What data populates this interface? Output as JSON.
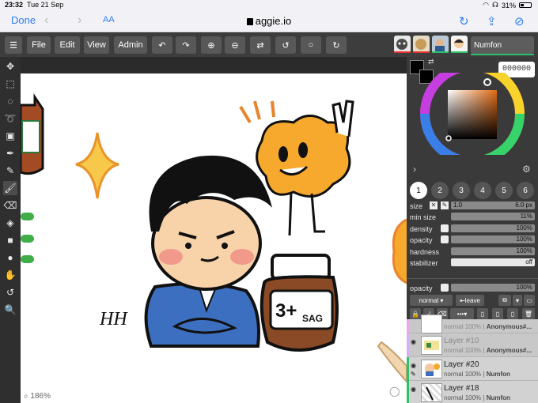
{
  "status": {
    "time": "23:32",
    "date": "Tue 21 Sep",
    "battery": "31%"
  },
  "browser": {
    "done": "Done",
    "text_size": "AA",
    "url": "aggie.io"
  },
  "menu": {
    "file": "File",
    "edit": "Edit",
    "view": "View",
    "admin": "Admin"
  },
  "user": {
    "name": "Numfon"
  },
  "color": {
    "hex": "000000",
    "current": "#000000",
    "accent": "#e98a2a"
  },
  "brush_settings": {
    "size_label": "size",
    "size_min": "1.0",
    "size_max": "6.0 px",
    "min_size_label": "min size",
    "min_size_value": "11%",
    "density_label": "density",
    "density_value": "100%",
    "opacity_label": "opacity",
    "opacity_value": "100%",
    "hardness_label": "hardness",
    "hardness_value": "100%",
    "stabilizer_label": "stabilizer",
    "stabilizer_value": "off"
  },
  "layer_opacity": {
    "label": "opacity",
    "value": "100%"
  },
  "layer_controls": {
    "blend_mode": "normal",
    "leave": "leave",
    "more": "•••"
  },
  "layers": [
    {
      "name": "",
      "mode": "normal",
      "opacity": "100%",
      "owner": "Anonymous#..."
    },
    {
      "name": "Layer #10",
      "mode": "normal",
      "opacity": "100%",
      "owner": "Anonymous#..."
    },
    {
      "name": "Layer #20",
      "mode": "normal",
      "opacity": "100%",
      "owner": "Numfon"
    },
    {
      "name": "Layer #18",
      "mode": "normal",
      "opacity": "100%",
      "owner": "Numfon"
    }
  ],
  "canvas": {
    "zoom": "186%"
  },
  "drawing_text": {
    "jar_label": "3+",
    "jar_label_2": "SAG",
    "signature": "HH"
  }
}
